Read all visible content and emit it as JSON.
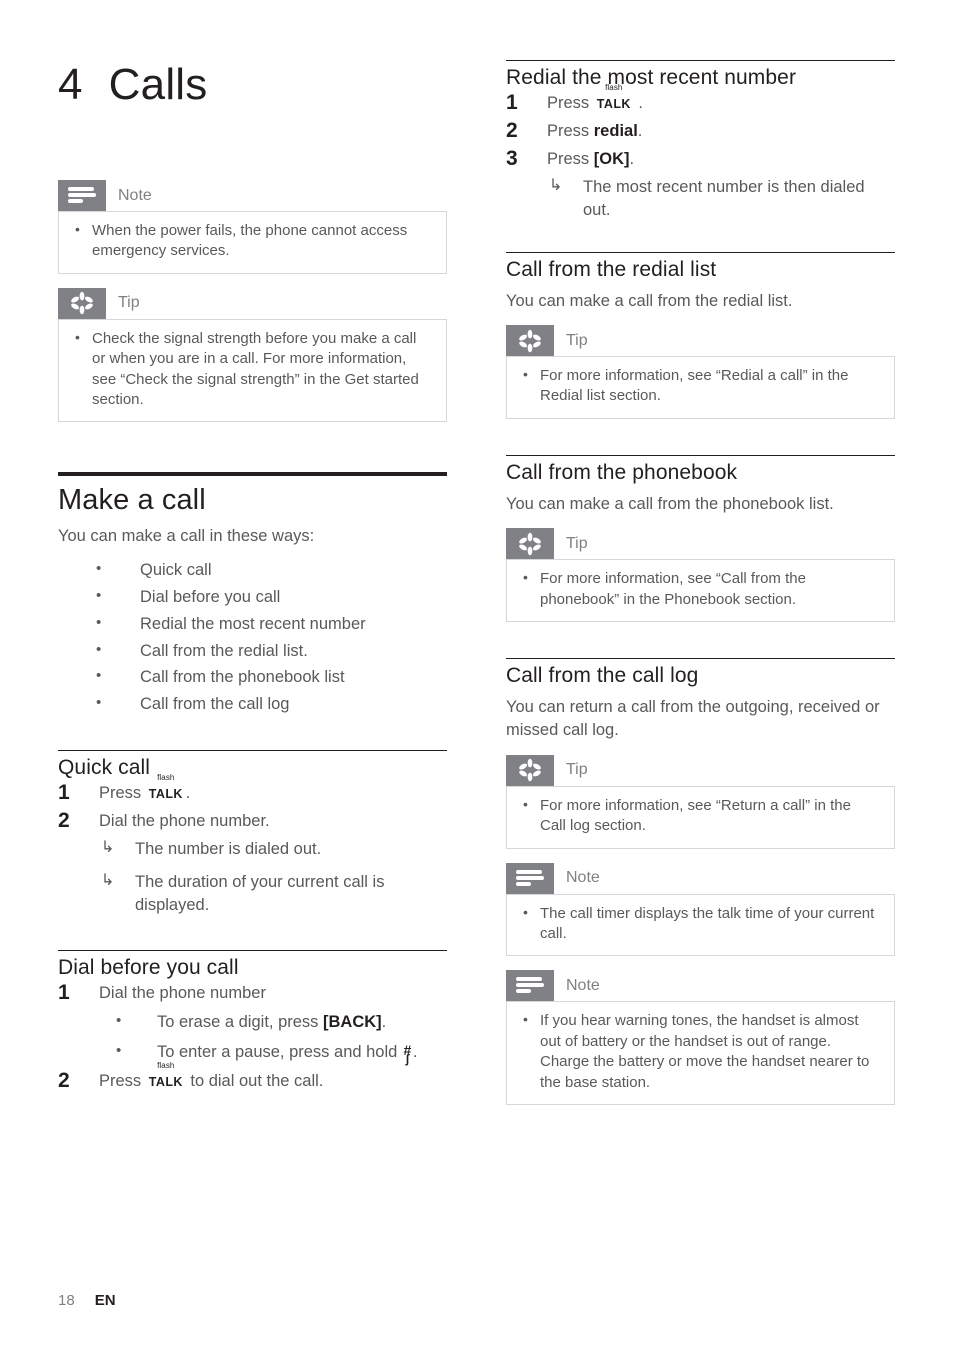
{
  "chapter": {
    "number": "4",
    "title": "Calls"
  },
  "footer": {
    "page_number": "18",
    "language": "EN"
  },
  "labels": {
    "note": "Note",
    "tip": "Tip"
  },
  "keys": {
    "talk_sup": "flash",
    "talk": "TALK",
    "hash": "#",
    "pause": "ʃ"
  },
  "left_column": {
    "note_top": {
      "label": "Note",
      "icon": "note-icon",
      "items": [
        "When the power fails, the phone cannot access emergency services."
      ]
    },
    "tip_top": {
      "label": "Tip",
      "icon": "tip-icon",
      "items": [
        "Check the signal strength before you make a call or when you are in a call. For more information, see “Check the signal strength” in the Get started section."
      ]
    },
    "make_a_call": {
      "heading": "Make a call",
      "intro": "You can make a call in these ways:",
      "ways": [
        "Quick call",
        "Dial before you call",
        "Redial the most recent number",
        "Call from the redial list.",
        "Call from the phonebook list",
        "Call from the call log"
      ]
    },
    "quick_call": {
      "heading": "Quick call",
      "step1_num": "1",
      "step1_pre": "Press",
      "step1_post": ".",
      "step2_num": "2",
      "step2_text": "Dial the phone number.",
      "results": [
        "The number is dialed out.",
        "The duration of your current call is displayed."
      ]
    },
    "dial_before": {
      "heading": "Dial before you call",
      "step1_num": "1",
      "step1_text": "Dial the phone number",
      "sub1_pre": "To erase a digit, press ",
      "sub1_key": "[BACK]",
      "sub1_post": ".",
      "sub2_pre": "To enter a pause, press and hold ",
      "sub2_post": ".",
      "step2_num": "2",
      "step2_pre": "Press",
      "step2_post": "to dial out the call."
    }
  },
  "right_column": {
    "redial_recent": {
      "heading": "Redial the most recent number",
      "step1_num": "1",
      "step1_pre": "Press",
      "step1_post": ".",
      "step2_num": "2",
      "step2_pre": "Press ",
      "step2_key": "redial",
      "step2_post": ".",
      "step3_num": "3",
      "step3_pre": "Press ",
      "step3_key": "[OK]",
      "step3_post": ".",
      "results": [
        "The most recent number is then dialed out."
      ]
    },
    "redial_list": {
      "heading": "Call from the redial list",
      "intro": "You can make a call from the redial list.",
      "tip": {
        "label": "Tip",
        "icon": "tip-icon",
        "items": [
          "For more information, see “Redial a call” in the Redial list section."
        ]
      }
    },
    "phonebook": {
      "heading": "Call from the phonebook",
      "intro": "You can make a call from the phonebook list.",
      "tip": {
        "label": "Tip",
        "icon": "tip-icon",
        "items": [
          "For more information, see “Call from the phonebook” in the Phonebook section."
        ]
      }
    },
    "call_log": {
      "heading": "Call from the call log",
      "intro": "You can return a call from the outgoing, received or missed call log.",
      "tip": {
        "label": "Tip",
        "icon": "tip-icon",
        "items": [
          "For more information, see “Return a call” in the Call log section."
        ]
      },
      "note1": {
        "label": "Note",
        "icon": "note-icon",
        "items": [
          "The call timer displays the talk time of your current call."
        ]
      },
      "note2": {
        "label": "Note",
        "icon": "note-icon",
        "items": [
          "If you hear warning tones, the handset is almost out of battery or the handset is out of range. Charge the battery or move the handset nearer to the base station."
        ]
      }
    }
  },
  "colors": {
    "body_text": "#58595b",
    "heading_text": "#231f20",
    "callout_tab": "#808184",
    "callout_border": "#d6d7d8"
  }
}
